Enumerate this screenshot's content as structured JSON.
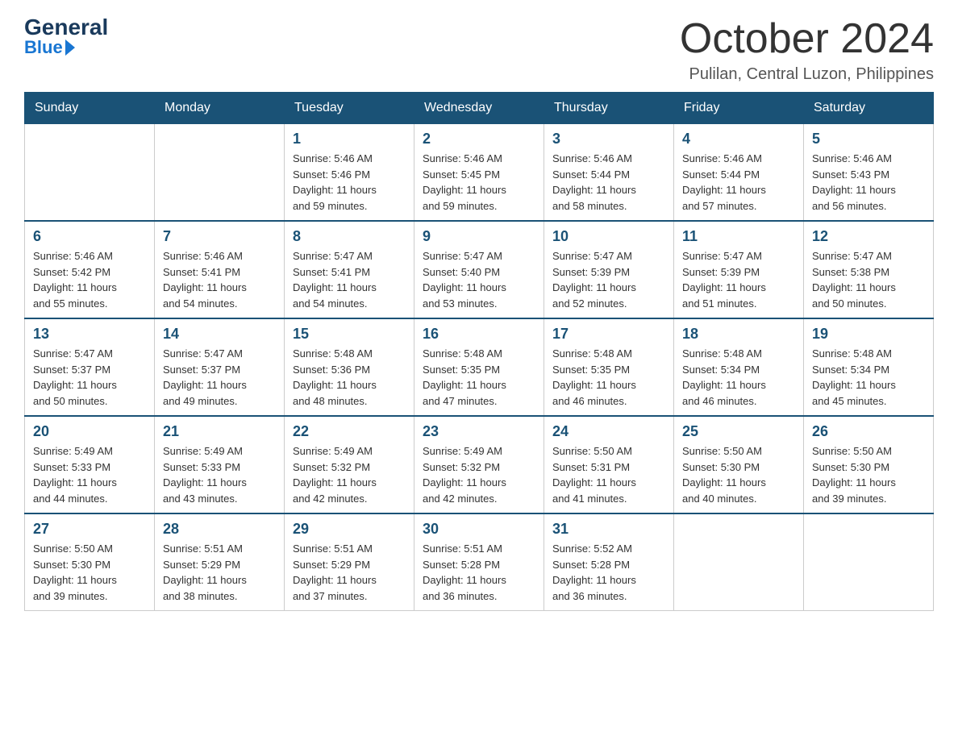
{
  "logo": {
    "general": "General",
    "blue": "Blue"
  },
  "title": "October 2024",
  "location": "Pulilan, Central Luzon, Philippines",
  "days_of_week": [
    "Sunday",
    "Monday",
    "Tuesday",
    "Wednesday",
    "Thursday",
    "Friday",
    "Saturday"
  ],
  "weeks": [
    [
      {
        "day": "",
        "info": ""
      },
      {
        "day": "",
        "info": ""
      },
      {
        "day": "1",
        "info": "Sunrise: 5:46 AM\nSunset: 5:46 PM\nDaylight: 11 hours\nand 59 minutes."
      },
      {
        "day": "2",
        "info": "Sunrise: 5:46 AM\nSunset: 5:45 PM\nDaylight: 11 hours\nand 59 minutes."
      },
      {
        "day": "3",
        "info": "Sunrise: 5:46 AM\nSunset: 5:44 PM\nDaylight: 11 hours\nand 58 minutes."
      },
      {
        "day": "4",
        "info": "Sunrise: 5:46 AM\nSunset: 5:44 PM\nDaylight: 11 hours\nand 57 minutes."
      },
      {
        "day": "5",
        "info": "Sunrise: 5:46 AM\nSunset: 5:43 PM\nDaylight: 11 hours\nand 56 minutes."
      }
    ],
    [
      {
        "day": "6",
        "info": "Sunrise: 5:46 AM\nSunset: 5:42 PM\nDaylight: 11 hours\nand 55 minutes."
      },
      {
        "day": "7",
        "info": "Sunrise: 5:46 AM\nSunset: 5:41 PM\nDaylight: 11 hours\nand 54 minutes."
      },
      {
        "day": "8",
        "info": "Sunrise: 5:47 AM\nSunset: 5:41 PM\nDaylight: 11 hours\nand 54 minutes."
      },
      {
        "day": "9",
        "info": "Sunrise: 5:47 AM\nSunset: 5:40 PM\nDaylight: 11 hours\nand 53 minutes."
      },
      {
        "day": "10",
        "info": "Sunrise: 5:47 AM\nSunset: 5:39 PM\nDaylight: 11 hours\nand 52 minutes."
      },
      {
        "day": "11",
        "info": "Sunrise: 5:47 AM\nSunset: 5:39 PM\nDaylight: 11 hours\nand 51 minutes."
      },
      {
        "day": "12",
        "info": "Sunrise: 5:47 AM\nSunset: 5:38 PM\nDaylight: 11 hours\nand 50 minutes."
      }
    ],
    [
      {
        "day": "13",
        "info": "Sunrise: 5:47 AM\nSunset: 5:37 PM\nDaylight: 11 hours\nand 50 minutes."
      },
      {
        "day": "14",
        "info": "Sunrise: 5:47 AM\nSunset: 5:37 PM\nDaylight: 11 hours\nand 49 minutes."
      },
      {
        "day": "15",
        "info": "Sunrise: 5:48 AM\nSunset: 5:36 PM\nDaylight: 11 hours\nand 48 minutes."
      },
      {
        "day": "16",
        "info": "Sunrise: 5:48 AM\nSunset: 5:35 PM\nDaylight: 11 hours\nand 47 minutes."
      },
      {
        "day": "17",
        "info": "Sunrise: 5:48 AM\nSunset: 5:35 PM\nDaylight: 11 hours\nand 46 minutes."
      },
      {
        "day": "18",
        "info": "Sunrise: 5:48 AM\nSunset: 5:34 PM\nDaylight: 11 hours\nand 46 minutes."
      },
      {
        "day": "19",
        "info": "Sunrise: 5:48 AM\nSunset: 5:34 PM\nDaylight: 11 hours\nand 45 minutes."
      }
    ],
    [
      {
        "day": "20",
        "info": "Sunrise: 5:49 AM\nSunset: 5:33 PM\nDaylight: 11 hours\nand 44 minutes."
      },
      {
        "day": "21",
        "info": "Sunrise: 5:49 AM\nSunset: 5:33 PM\nDaylight: 11 hours\nand 43 minutes."
      },
      {
        "day": "22",
        "info": "Sunrise: 5:49 AM\nSunset: 5:32 PM\nDaylight: 11 hours\nand 42 minutes."
      },
      {
        "day": "23",
        "info": "Sunrise: 5:49 AM\nSunset: 5:32 PM\nDaylight: 11 hours\nand 42 minutes."
      },
      {
        "day": "24",
        "info": "Sunrise: 5:50 AM\nSunset: 5:31 PM\nDaylight: 11 hours\nand 41 minutes."
      },
      {
        "day": "25",
        "info": "Sunrise: 5:50 AM\nSunset: 5:30 PM\nDaylight: 11 hours\nand 40 minutes."
      },
      {
        "day": "26",
        "info": "Sunrise: 5:50 AM\nSunset: 5:30 PM\nDaylight: 11 hours\nand 39 minutes."
      }
    ],
    [
      {
        "day": "27",
        "info": "Sunrise: 5:50 AM\nSunset: 5:30 PM\nDaylight: 11 hours\nand 39 minutes."
      },
      {
        "day": "28",
        "info": "Sunrise: 5:51 AM\nSunset: 5:29 PM\nDaylight: 11 hours\nand 38 minutes."
      },
      {
        "day": "29",
        "info": "Sunrise: 5:51 AM\nSunset: 5:29 PM\nDaylight: 11 hours\nand 37 minutes."
      },
      {
        "day": "30",
        "info": "Sunrise: 5:51 AM\nSunset: 5:28 PM\nDaylight: 11 hours\nand 36 minutes."
      },
      {
        "day": "31",
        "info": "Sunrise: 5:52 AM\nSunset: 5:28 PM\nDaylight: 11 hours\nand 36 minutes."
      },
      {
        "day": "",
        "info": ""
      },
      {
        "day": "",
        "info": ""
      }
    ]
  ]
}
